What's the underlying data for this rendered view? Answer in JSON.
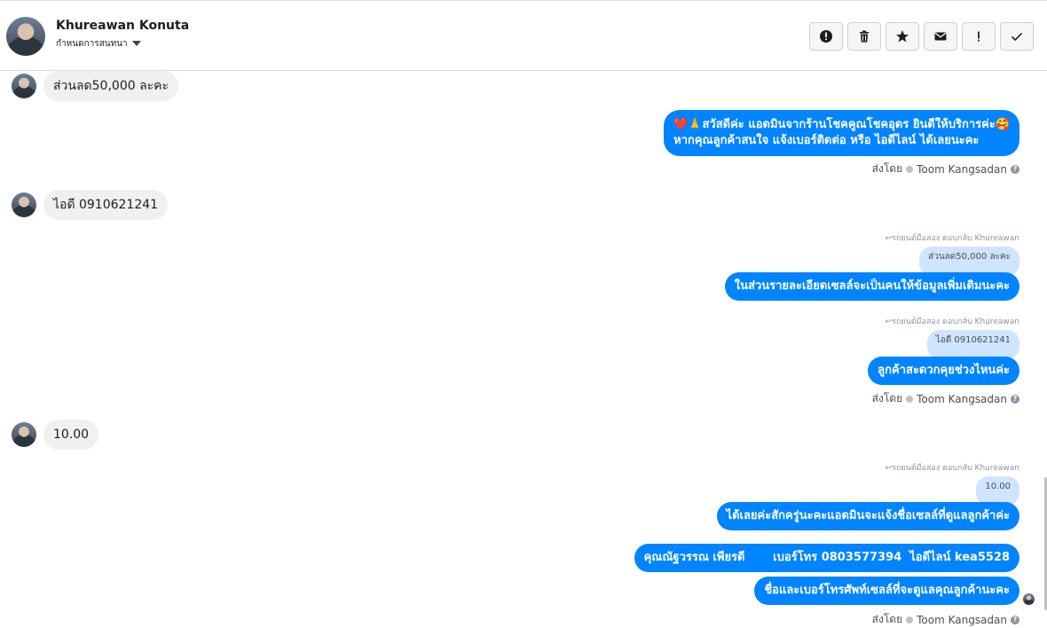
{
  "header": {
    "name": "Khureawan Konuta",
    "subtitle": "กำหนดการสนทนา"
  },
  "actions": [
    {
      "name": "spam-button",
      "icon": "alert-circle-icon"
    },
    {
      "name": "delete-button",
      "icon": "trash-icon"
    },
    {
      "name": "star-button",
      "icon": "star-icon"
    },
    {
      "name": "mark-unread-button",
      "icon": "envelope-icon"
    },
    {
      "name": "follow-up-button",
      "icon": "exclamation-icon"
    },
    {
      "name": "done-button",
      "icon": "checkmark-icon"
    }
  ],
  "messages": {
    "in1": "ส่วนลด50,000 ละคะ",
    "out1_line1": "❤️🙏สวัสดีค่ะ แอดมินจากร้านโชคคูณโชคอุดร ยินดีให้บริการค่ะ🥰",
    "out1_line2": "หากคุณลูกค้าสนใจ แจ้งเบอร์ติดต่อ หรือ ไอดีไลน์ ได้เลยนะคะ",
    "sent_by_1": "ส่งโดย",
    "sender_1": "Toom Kangsadan",
    "in2": "ไอดี 0910621241",
    "reply1_label": "↩รถยนต์มือสอง ตอบกลับ Khureawan",
    "reply1_quote": "ส่วนลด50,000 ละคะ",
    "out2": "ในส่วนรายละเอียดเซลล์จะเป็นคนให้ข้อมูลเพิ่มเติมนะคะ",
    "reply2_label": "↩รถยนต์มือสอง ตอบกลับ Khureawan",
    "reply2_quote": "ไอดี 0910621241",
    "out3": "ลูกค้าสะดวกคุยช่วงไหนค่ะ",
    "sent_by_2": "ส่งโดย",
    "sender_2": "Toom Kangsadan",
    "in3": "10.00",
    "reply3_label": "↩รถยนต์มือสอง ตอบกลับ Khureawan",
    "reply3_quote": "10.00",
    "out4": "ได้เลยค่ะสักครู่นะคะแอดมินจะแจ้งชื่อเซลล์ที่ดูแลลูกค้าค่ะ",
    "out5": "คุณณัฐวรรณ เพียรดี       เบอร์โทร 0803577394  ไอดีไลน์ kea5528",
    "out6": "ชื่อและเบอร์โทรศัพท์เซลล์ที่จะดูแลคุณลูกค้านะคะ",
    "sent_by_3": "ส่งโดย",
    "sender_3": "Toom Kangsadan"
  },
  "colors": {
    "outgoing": "#0084ff",
    "incoming": "#f0f0f0",
    "quote": "#cfe4ff"
  }
}
